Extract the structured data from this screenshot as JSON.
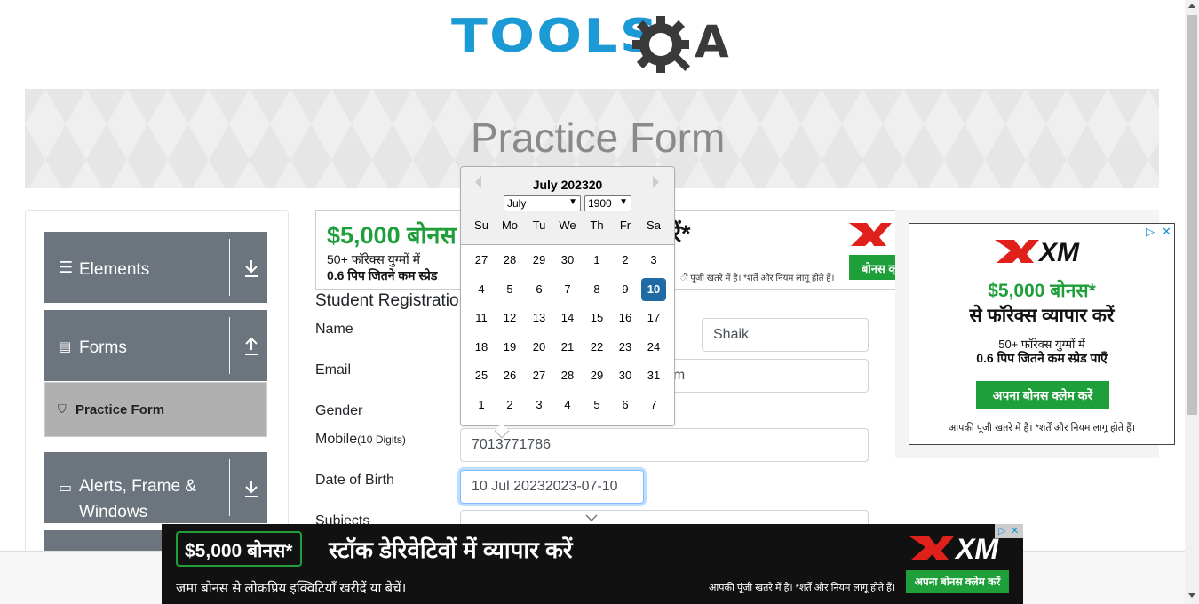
{
  "header": {
    "logo_text_tools": "TOOLS",
    "logo_text_a": "A",
    "banner_title": "Practice Form"
  },
  "sidebar": {
    "groups": [
      {
        "label": "Elements",
        "icon": "hamburger-icon",
        "arrow": "download-arrow-icon"
      },
      {
        "label": "Forms",
        "icon": "document-icon",
        "arrow": "upload-arrow-icon"
      },
      {
        "label": "Alerts, Frame & Windows",
        "icon": "window-icon",
        "arrow": "download-arrow-icon"
      }
    ],
    "active_item": {
      "label": "Practice Form",
      "icon": "shield-icon"
    }
  },
  "form": {
    "title": "Student Registration Form",
    "name_label": "Name",
    "last_name_value": "Shaik",
    "email_label": "Email",
    "email_value_visible": "om",
    "gender_label": "Gender",
    "mobile_label": "Mobile",
    "mobile_hint": "(10 Digits)",
    "mobile_value": "7013771786",
    "dob_label": "Date of Birth",
    "dob_value": "10 Jul 20232023-07-10",
    "subjects_label": "Subjects"
  },
  "calendar": {
    "title": "July 202320",
    "month_select": "July",
    "year_select": "1900",
    "weekdays": [
      "Su",
      "Mo",
      "Tu",
      "We",
      "Th",
      "Fr",
      "Sa"
    ],
    "weeks": [
      [
        "27",
        "28",
        "29",
        "30",
        "1",
        "2",
        "3"
      ],
      [
        "4",
        "5",
        "6",
        "7",
        "8",
        "9",
        "10"
      ],
      [
        "11",
        "12",
        "13",
        "14",
        "15",
        "16",
        "17"
      ],
      [
        "18",
        "19",
        "20",
        "21",
        "22",
        "23",
        "24"
      ],
      [
        "25",
        "26",
        "27",
        "28",
        "29",
        "30",
        "31"
      ],
      [
        "1",
        "2",
        "3",
        "4",
        "5",
        "6",
        "7"
      ]
    ],
    "selected_day": "10"
  },
  "ad_mid": {
    "headline": "$5,000 बोनस",
    "headline_end": "रें*",
    "line1": "50+ फॉरेक्स युग्मों में",
    "line2": "0.6 पिप जितने कम स्प्रेड",
    "fine": "ी पूंजी खतरे में है। *शर्तें और नियम लागू होते हैं।",
    "button": "बोनस क्"
  },
  "ad_right": {
    "brand": "XM",
    "headline1": "$5,000 बोनस*",
    "headline2": "से फॉरेक्स व्यापार करें",
    "line1": "50+ फॉरेक्स युग्मों में",
    "line2": "0.6 पिप जितने कम स्प्रेड पाएँ",
    "button": "अपना बोनस क्लेम करें",
    "fine": "आपकी पूंजी खतरे में है। *शर्तें और नियम लागू होते हैं।"
  },
  "ad_bottom": {
    "badge": "$5,000 बोनस*",
    "headline": "स्टॉक डेरिवेटिवों में व्यापार करें",
    "sub": "जमा बोनस से लोकप्रिय इक्विटियाँ खरीदें या बेचें।",
    "fine": "आपकी पूंजी खतरे में है। *शर्तें और नियम लागू होते हैं।",
    "button": "अपना बोनस क्लेम करें",
    "brand": "XM"
  },
  "colors": {
    "brand_blue": "#1c9ad6",
    "sidebar_gray": "#6c757d",
    "ad_green": "#1e9f3a",
    "selected_day": "#216ba5"
  }
}
